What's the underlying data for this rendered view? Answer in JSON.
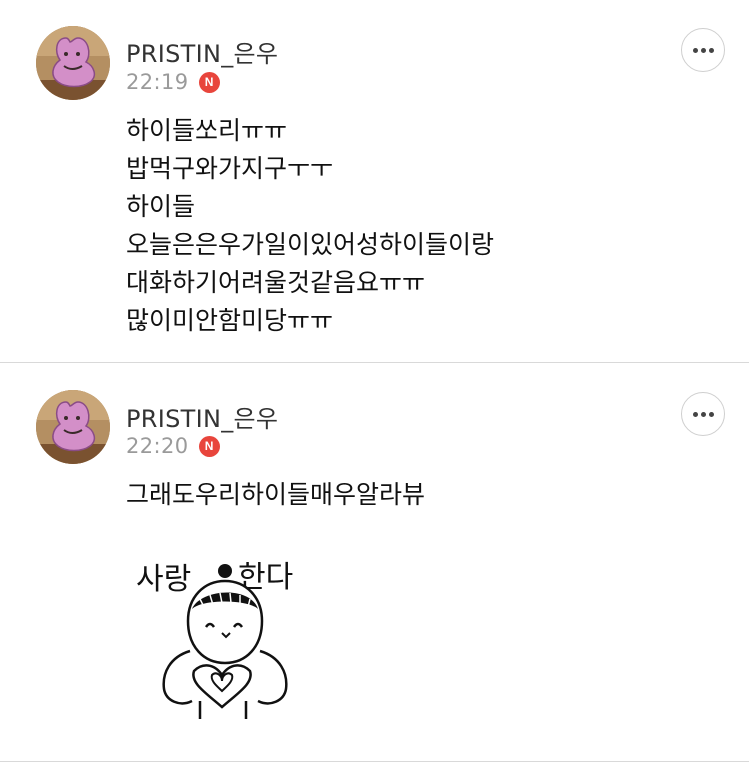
{
  "posts": [
    {
      "username": "PRISTIN_은우",
      "time": "22:19",
      "badge": "N",
      "lines": [
        "하이들쏘리ㅠㅠ",
        "밥먹구와가지구ㅜㅜ",
        "하이들",
        "오늘은은우가일이있어성하이들이랑",
        "대화하기어려울것같음요ㅠㅠ",
        "많이미안함미당ㅠㅠ"
      ]
    },
    {
      "username": "PRISTIN_은우",
      "time": "22:20",
      "badge": "N",
      "lines": [
        "그래도우리하이들매우알라뷰"
      ],
      "sticker": {
        "icon": "love-you-character-sticker",
        "text_left": "사랑",
        "text_right": "한다"
      }
    }
  ],
  "colors": {
    "badge": "#e8453c",
    "timestamp": "#9a9a9a",
    "divider": "#d9d9d9"
  }
}
